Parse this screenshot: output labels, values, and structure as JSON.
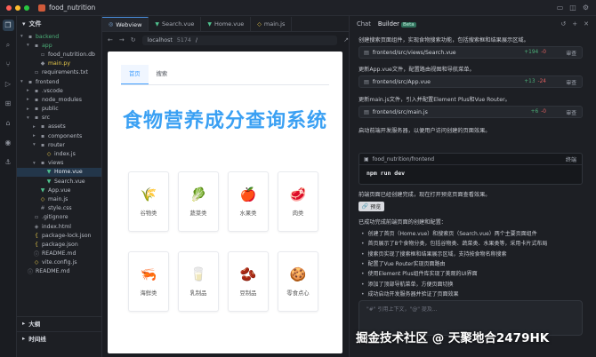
{
  "window": {
    "title": "food_nutrition",
    "traffic_colors": [
      "#ff5f57",
      "#febc2e",
      "#28c840"
    ]
  },
  "explorer": {
    "header": "文件",
    "tree": [
      {
        "label": "backend",
        "indent": 0,
        "arrow": "▾",
        "icon": "folder-icon",
        "color": "#4caf78"
      },
      {
        "label": "app",
        "indent": 1,
        "arrow": "▾",
        "icon": "folder-icon",
        "color": "#4caf78"
      },
      {
        "label": "food_nutrition.db",
        "indent": 2,
        "arrow": "",
        "icon": "file-icon",
        "color": "#b8bcc5"
      },
      {
        "label": "main.py",
        "indent": 2,
        "arrow": "",
        "icon": "python-icon",
        "color": "#e6c84a"
      },
      {
        "label": "requirements.txt",
        "indent": 1,
        "arrow": "",
        "icon": "file-icon",
        "color": "#b8bcc5"
      },
      {
        "label": "frontend",
        "indent": 0,
        "arrow": "▾",
        "icon": "folder-icon",
        "color": "#b8bcc5"
      },
      {
        "label": ".vscode",
        "indent": 1,
        "arrow": "▸",
        "icon": "folder-icon",
        "color": "#b8bcc5"
      },
      {
        "label": "node_modules",
        "indent": 1,
        "arrow": "▸",
        "icon": "folder-icon",
        "color": "#b8bcc5"
      },
      {
        "label": "public",
        "indent": 1,
        "arrow": "▸",
        "icon": "folder-icon",
        "color": "#b8bcc5"
      },
      {
        "label": "src",
        "indent": 1,
        "arrow": "▾",
        "icon": "folder-icon",
        "color": "#b8bcc5"
      },
      {
        "label": "assets",
        "indent": 2,
        "arrow": "▸",
        "icon": "folder-icon",
        "color": "#b8bcc5"
      },
      {
        "label": "components",
        "indent": 2,
        "arrow": "▸",
        "icon": "folder-icon",
        "color": "#b8bcc5"
      },
      {
        "label": "router",
        "indent": 2,
        "arrow": "▾",
        "icon": "folder-icon",
        "color": "#b8bcc5"
      },
      {
        "label": "index.js",
        "indent": 3,
        "arrow": "",
        "icon": "js-icon",
        "color": "#b8bcc5"
      },
      {
        "label": "views",
        "indent": 2,
        "arrow": "▾",
        "icon": "folder-icon",
        "color": "#b8bcc5"
      },
      {
        "label": "Home.vue",
        "indent": 3,
        "arrow": "",
        "icon": "vue-icon",
        "color": "#e4e8ef",
        "selected": true
      },
      {
        "label": "Search.vue",
        "indent": 3,
        "arrow": "",
        "icon": "vue-icon",
        "color": "#b8bcc5"
      },
      {
        "label": "App.vue",
        "indent": 2,
        "arrow": "",
        "icon": "vue-icon",
        "color": "#b8bcc5"
      },
      {
        "label": "main.js",
        "indent": 2,
        "arrow": "",
        "icon": "js-icon",
        "color": "#b8bcc5"
      },
      {
        "label": "style.css",
        "indent": 2,
        "arrow": "",
        "icon": "css-icon",
        "color": "#b8bcc5"
      },
      {
        "label": ".gitignore",
        "indent": 1,
        "arrow": "",
        "icon": "file-icon",
        "color": "#b8bcc5"
      },
      {
        "label": "index.html",
        "indent": 1,
        "arrow": "",
        "icon": "html-icon",
        "color": "#b8bcc5"
      },
      {
        "label": "package-lock.json",
        "indent": 1,
        "arrow": "",
        "icon": "json-icon",
        "color": "#b8bcc5"
      },
      {
        "label": "package.json",
        "indent": 1,
        "arrow": "",
        "icon": "json-icon",
        "color": "#b8bcc5"
      },
      {
        "label": "README.md",
        "indent": 1,
        "arrow": "",
        "icon": "md-icon",
        "color": "#b8bcc5"
      },
      {
        "label": "vite.config.js",
        "indent": 1,
        "arrow": "",
        "icon": "js-icon",
        "color": "#b8bcc5"
      },
      {
        "label": "README.md",
        "indent": 0,
        "arrow": "",
        "icon": "md-icon",
        "color": "#b8bcc5"
      }
    ],
    "outline_label": "大纲",
    "timeline_label": "时间线"
  },
  "editor": {
    "tabs": [
      {
        "label": "Webview",
        "active": true,
        "icon": "globe-icon"
      },
      {
        "label": "Search.vue",
        "active": false,
        "icon": "vue-icon"
      },
      {
        "label": "Home.vue",
        "active": false,
        "icon": "vue-icon"
      },
      {
        "label": "main.js",
        "active": false,
        "icon": "js-icon"
      }
    ],
    "url": {
      "host": "localhost",
      "port": "5174",
      "path": "/"
    }
  },
  "webview": {
    "nav": [
      {
        "label": "首页",
        "active": true
      },
      {
        "label": "搜索",
        "active": false
      }
    ],
    "title": "食物营养成分查询系统",
    "cards": [
      {
        "label": "谷物类",
        "emoji": "🌾"
      },
      {
        "label": "蔬菜类",
        "emoji": "🥬"
      },
      {
        "label": "水果类",
        "emoji": "🍎"
      },
      {
        "label": "肉类",
        "emoji": "🥩"
      },
      {
        "label": "海鲜类",
        "emoji": "🦐"
      },
      {
        "label": "乳制品",
        "emoji": "🥛"
      },
      {
        "label": "豆制品",
        "emoji": "🫘"
      },
      {
        "label": "零食点心",
        "emoji": "🍪"
      }
    ]
  },
  "chat": {
    "tabs": [
      {
        "label": "Chat"
      },
      {
        "label": "Builder"
      }
    ],
    "beta_label": "Beta",
    "intro_text": "创建搜索页面组件，实现食物搜索功能，包括搜索框和结果展示区域。",
    "steps": [
      {
        "file": "frontend/src/views/Search.vue",
        "plus": "+194",
        "minus": "-0",
        "review": "审查"
      },
      {
        "desc": "更新App.vue文件，配置路由视图和导航菜单。",
        "file": "frontend/src/App.vue",
        "plus": "+13",
        "minus": "-24",
        "review": "审查"
      },
      {
        "desc": "更新main.js文件，引入并配置Element Plus和Vue Router。",
        "file": "frontend/src/main.js",
        "plus": "+6",
        "minus": "-0",
        "review": "审查"
      }
    ],
    "start_text": "启动前端开发服务器，以便用户访问创建的页面效果。",
    "terminal": {
      "cwd": "food_nutrition/frontend",
      "status": "终端",
      "command": "npm run dev"
    },
    "done_text": "前端页面已经创建完成，现在打开预览页面查看效果。",
    "preview_label": "预览",
    "summary_title": "已成功完成前端页面的创建和配置：",
    "bullets": [
      "创建了首页（Home.vue）和搜索页（Search.vue）两个主要页面组件",
      "首页展示了8个食物分类，包括谷物类、蔬菜类、水果类等，采用卡片式布局",
      "搜索页实现了搜索框和结果展示区域，支持按食物名称搜索",
      "配置了Vue Router实现页面路由",
      "使用Element Plus组件库实现了美观的UI界面",
      "添加了顶部导航菜单，方便页面切换",
      "成功启动开发服务器并验证了页面效果"
    ],
    "input_placeholder": "\"#\" 引用上下文，\"@\" 提及..."
  },
  "watermark": "掘金技术社区 @ 天聚地合2479HK"
}
